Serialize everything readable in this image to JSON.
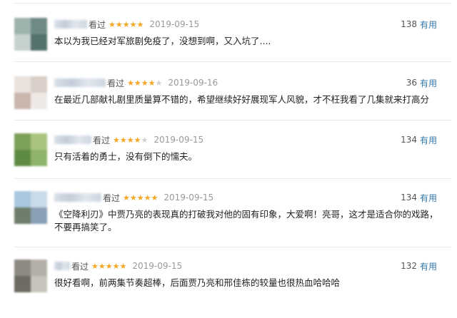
{
  "comments": [
    {
      "status": "看过",
      "rating": 5,
      "date": "2019-09-15",
      "votes": "138",
      "useful_label": "有用",
      "content": "本以为我已经对军旅剧免疫了，没想到啊，又入坑了....",
      "avatar_colors": [
        "#9fb3ad",
        "#6f8a86",
        "#c5d2cf",
        "#55716d"
      ]
    },
    {
      "status": "看过",
      "rating": 4,
      "date": "2019-09-16",
      "votes": "36",
      "useful_label": "有用",
      "content": "在最近几部献礼剧里质量算不错的，希望继续好好展现军人风貌，才不枉我看了几集就来打高分",
      "avatar_colors": [
        "#e9e2dd",
        "#d9cfc8",
        "#c9b6ad",
        "#efe9e5"
      ]
    },
    {
      "status": "看过",
      "rating": 4,
      "date": "2019-09-15",
      "votes": "134",
      "useful_label": "有用",
      "content": "只有活着的勇士，没有倒下的懦夫。",
      "avatar_colors": [
        "#7da05a",
        "#a8c47f",
        "#5f8a44",
        "#8fb36a"
      ]
    },
    {
      "status": "看过",
      "rating": 5,
      "date": "2019-09-15",
      "votes": "134",
      "useful_label": "有用",
      "content": "《空降利刃》中贾乃亮的表现真的打破我对他的固有印象，大爱啊！亮哥，这才是适合你的戏路，不要再搞笑了。",
      "avatar_colors": [
        "#a9c7e0",
        "#c9dbe9",
        "#6f7d6b",
        "#8aa0b4"
      ]
    },
    {
      "status": "看过",
      "rating": 5,
      "date": "2019-09-15",
      "votes": "132",
      "useful_label": "有用",
      "content": "很好看啊，前两集节奏超棒，后面贾乃亮和邢佳栋的较量也很热血哈哈哈",
      "avatar_colors": [
        "#8d8a84",
        "#b4b0a9",
        "#6e6a64",
        "#c8c4bd"
      ]
    }
  ]
}
